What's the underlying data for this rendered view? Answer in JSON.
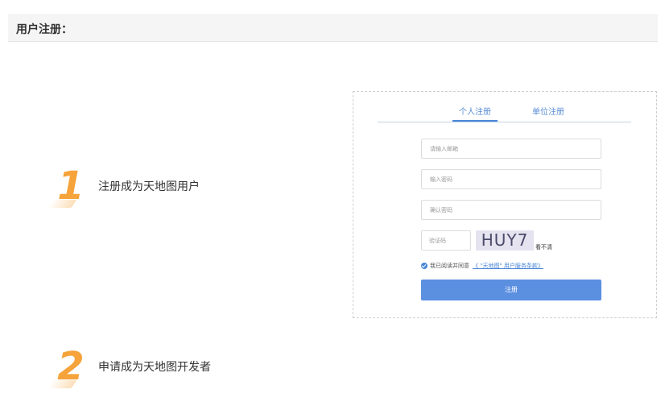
{
  "header": {
    "title": "用户注册："
  },
  "steps": [
    {
      "number": "1",
      "label": "注册成为天地图用户"
    },
    {
      "number": "2",
      "label": "申请成为天地图开发者"
    }
  ],
  "form": {
    "tabs": [
      {
        "label": "个人注册",
        "active": true
      },
      {
        "label": "单位注册",
        "active": false
      }
    ],
    "email_placeholder": "请输入邮箱",
    "password_placeholder": "输入密码",
    "confirm_placeholder": "确认密码",
    "captcha_placeholder": "验证码",
    "captcha_text": "HUY7",
    "refresh_label": "看不清",
    "agree_text": "我已阅读并同意",
    "terms_link": "《 \"天地图\" 用户服务条款》",
    "submit_label": "注册"
  },
  "colors": {
    "accent": "#5b8fe0",
    "step_number": "#f5a33a",
    "header_bg": "#f5f5f5"
  }
}
